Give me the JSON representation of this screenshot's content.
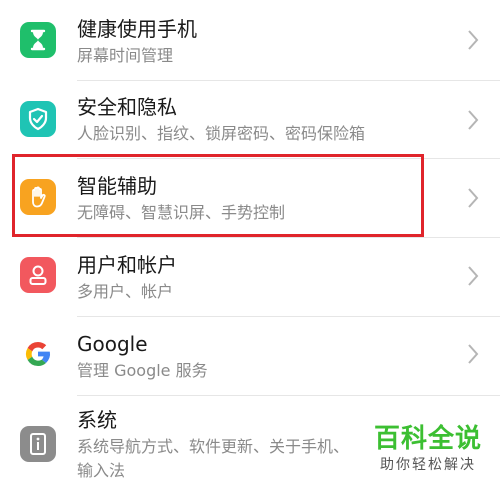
{
  "settings_items": [
    {
      "title": "健康使用手机",
      "subtitle": "屏幕时间管理",
      "icon": "hourglass-icon",
      "color": "#1fbf6b"
    },
    {
      "title": "安全和隐私",
      "subtitle": "人脸识别、指纹、锁屏密码、密码保险箱",
      "icon": "shield-check-icon",
      "color": "#1fc4b4"
    },
    {
      "title": "智能辅助",
      "subtitle": "无障碍、智慧识屏、手势控制",
      "icon": "hand-icon",
      "color": "#f8a320"
    },
    {
      "title": "用户和帐户",
      "subtitle": "多用户、帐户",
      "icon": "user-icon",
      "color": "#f2585e"
    },
    {
      "title": "Google",
      "subtitle": "管理 Google 服务",
      "icon": "google-icon",
      "color": "#ffffff"
    },
    {
      "title": "系统",
      "subtitle": "系统导航方式、软件更新、关于手机、",
      "subtitle2": "输入法",
      "icon": "info-icon",
      "color": "#8c8c8c"
    }
  ],
  "highlight_color": "#e0242b",
  "watermark": {
    "title": "百科全说",
    "tagline": "助你轻松解决",
    "color": "#3cbf32"
  }
}
